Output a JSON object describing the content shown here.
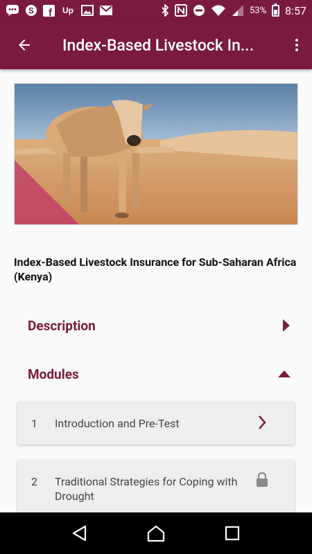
{
  "status_bar": {
    "battery": "53%",
    "time": "8:57",
    "left_icons": [
      "chat-icon",
      "skype-icon",
      "facebook-icon",
      "upwork-icon",
      "image-icon",
      "gmail-icon"
    ],
    "right_icons": [
      "bluetooth-icon",
      "nfc-icon",
      "dnd-icon",
      "wifi-icon",
      "signal-icon",
      "battery-icon"
    ]
  },
  "app_bar": {
    "title": "Index-Based Livestock In...",
    "back_icon": "arrow-back-icon",
    "menu_icon": "more-vert-icon"
  },
  "course": {
    "title": "Index-Based Livestock Insurance for Sub-Saharan Africa (Kenya)",
    "image": "cow-in-desert-image"
  },
  "sections": {
    "description": {
      "label": "Description",
      "icon": "triangle-right-icon"
    },
    "modules": {
      "label": "Modules",
      "icon": "triangle-up-icon"
    }
  },
  "modules": [
    {
      "number": "1",
      "title": "Introduction and Pre-Test",
      "status_icon": "chevron-right-icon"
    },
    {
      "number": "2",
      "title": "Traditional Strategies for Coping with Drought",
      "status_icon": "lock-icon"
    }
  ],
  "colors": {
    "primary": "#7a1a3f",
    "card": "#eeeeee",
    "background": "#fafafa"
  }
}
